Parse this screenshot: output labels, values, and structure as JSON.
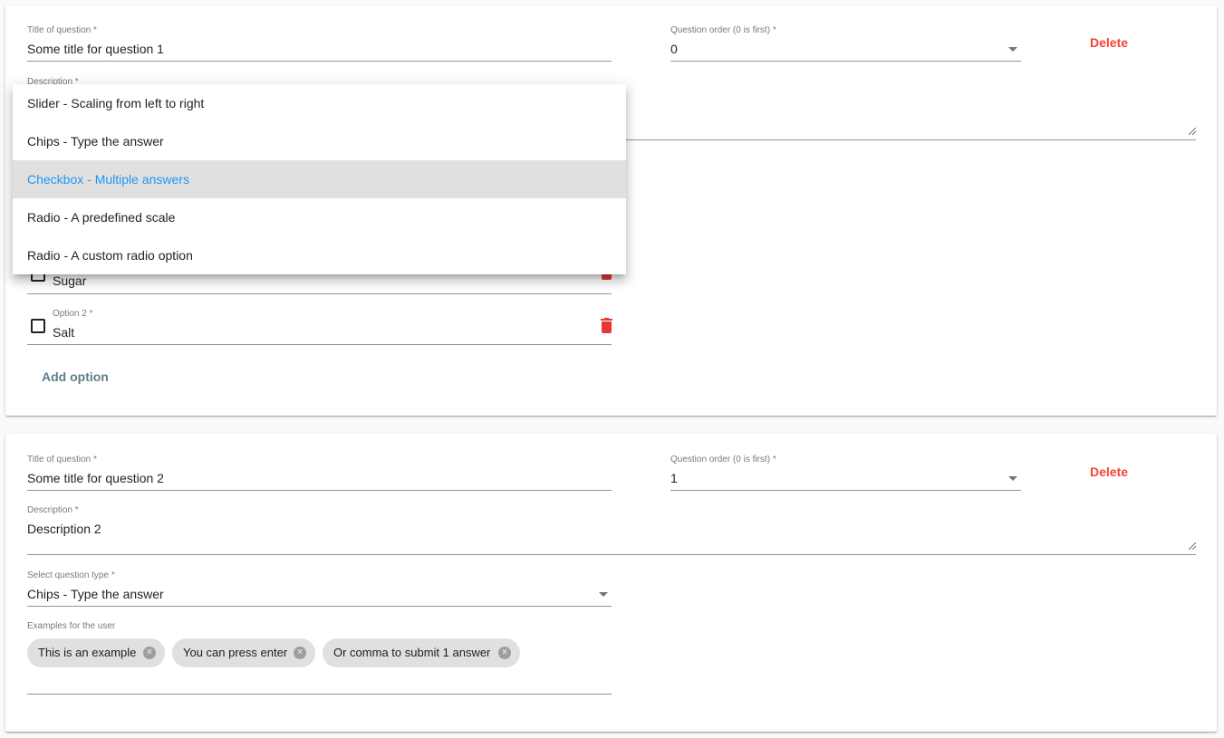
{
  "questions": [
    {
      "title_label": "Title of question *",
      "title_value": "Some title for question 1",
      "order_label": "Question order (0 is first) *",
      "order_value": "0",
      "delete_label": "Delete",
      "description_label": "Description *",
      "options": [
        {
          "value": "Sugar"
        },
        {
          "label": "Option 2 *",
          "value": "Salt"
        }
      ],
      "add_option_label": "Add option"
    },
    {
      "title_label": "Title of question *",
      "title_value": "Some title for question 2",
      "order_label": "Question order (0 is first) *",
      "order_value": "1",
      "delete_label": "Delete",
      "description_label": "Description *",
      "description_value": "Description 2",
      "type_label": "Select question type *",
      "type_value": "Chips - Type the answer",
      "examples_label": "Examples for the user",
      "chips": [
        "This is an example",
        "You can press enter",
        "Or comma to submit 1 answer"
      ]
    }
  ],
  "type_menu": {
    "items": [
      "Slider - Scaling from left to right",
      "Chips - Type the answer",
      "Checkbox - Multiple answers",
      "Radio - A predefined scale",
      "Radio - A custom radio option"
    ],
    "selected": "Checkbox - Multiple answers"
  },
  "colors": {
    "accent": "#2196f3",
    "delete": "#f44336",
    "add_option": "#607d8b"
  }
}
